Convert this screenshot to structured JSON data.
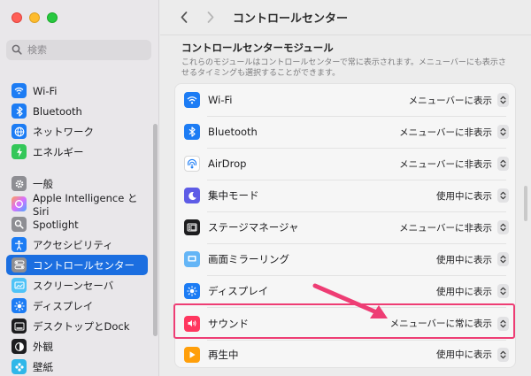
{
  "window": {
    "title": "コントロールセンター"
  },
  "search": {
    "placeholder": "検索"
  },
  "sidebar": {
    "items": [
      {
        "label": "Wi-Fi",
        "icon": "wifi-icon",
        "color": "#1c7cf4"
      },
      {
        "label": "Bluetooth",
        "icon": "bluetooth-icon",
        "color": "#1c7cf4"
      },
      {
        "label": "ネットワーク",
        "icon": "globe-icon",
        "color": "#1c7cf4"
      },
      {
        "label": "エネルギー",
        "icon": "battery-icon",
        "color": "#34c759"
      },
      {
        "label": "一般",
        "icon": "gear-icon",
        "color": "#8e8e93"
      },
      {
        "label": "Apple Intelligence とSiri",
        "icon": "siri-icon",
        "color": "#d86fff"
      },
      {
        "label": "Spotlight",
        "icon": "magnifier-icon",
        "color": "#8e8e93"
      },
      {
        "label": "アクセシビリティ",
        "icon": "accessibility-icon",
        "color": "#1c7cf4"
      },
      {
        "label": "コントロールセンター",
        "icon": "control-center-icon",
        "color": "#8e8e93",
        "active": true
      },
      {
        "label": "スクリーンセーバ",
        "icon": "screensaver-icon",
        "color": "#4fc3f7"
      },
      {
        "label": "ディスプレイ",
        "icon": "sun-icon",
        "color": "#1c7cf4"
      },
      {
        "label": "デスクトップとDock",
        "icon": "dock-icon",
        "color": "#1d1d1f"
      },
      {
        "label": "外観",
        "icon": "appearance-icon",
        "color": "#1d1d1f"
      },
      {
        "label": "壁紙",
        "icon": "wallpaper-icon",
        "color": "#2fb7e9"
      }
    ]
  },
  "section": {
    "title": "コントロールセンターモジュール",
    "description": "これらのモジュールはコントロールセンターで常に表示されます。メニューバーにも表示させるタイミングも選択することができます。"
  },
  "modules": [
    {
      "label": "Wi-Fi",
      "value": "メニューバーに表示",
      "icon": "wifi-icon",
      "color": "#1c7cf4"
    },
    {
      "label": "Bluetooth",
      "value": "メニューバーに非表示",
      "icon": "bluetooth-icon",
      "color": "#1c7cf4"
    },
    {
      "label": "AirDrop",
      "value": "メニューバーに非表示",
      "icon": "airdrop-icon",
      "color": "#ffffff"
    },
    {
      "label": "集中モード",
      "value": "使用中に表示",
      "icon": "moon-icon",
      "color": "#5e5ce6"
    },
    {
      "label": "ステージマネージャ",
      "value": "メニューバーに非表示",
      "icon": "stage-manager-icon",
      "color": "#1d1d1f"
    },
    {
      "label": "画面ミラーリング",
      "value": "使用中に表示",
      "icon": "mirroring-icon",
      "color": "#64b5f6"
    },
    {
      "label": "ディスプレイ",
      "value": "使用中に表示",
      "icon": "sun-icon",
      "color": "#1c7cf4"
    },
    {
      "label": "サウンド",
      "value": "メニューバーに常に表示",
      "icon": "speaker-icon",
      "color": "#ff375f"
    },
    {
      "label": "再生中",
      "value": "使用中に表示",
      "icon": "play-icon",
      "color": "#ff9f0a"
    }
  ],
  "annotation": {
    "color": "#ee3d74"
  }
}
